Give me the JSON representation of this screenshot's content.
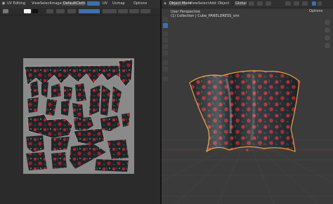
{
  "uv_editor": {
    "header": {
      "editor_type_icon": "image-editor-icon",
      "mode": "UV Editing",
      "menus": [
        "View",
        "Select",
        "Image"
      ],
      "image_name": "DefaultCloth",
      "right_menus": [
        "UV",
        "Uvmap",
        "Options"
      ]
    }
  },
  "viewport": {
    "header": {
      "mode": "Object Mode",
      "menus": [
        "View",
        "Select",
        "Add",
        "Object"
      ],
      "right_menus": [
        "Global",
        "Options"
      ]
    },
    "overlay": {
      "line1": "User Perspective",
      "line2": "(1) Collection | Cube_PANELDRESS_sim"
    },
    "tools": [
      "cursor-icon",
      "move-icon",
      "rotate-icon",
      "scale-icon",
      "transform-icon",
      "annotate-icon",
      "measure-icon",
      "add-cube-icon"
    ]
  },
  "colors": {
    "fabric_base": "#1e2427",
    "rose": "#b3262c",
    "leaf": "#2f5a58",
    "outline": "#f0a040",
    "uv_bg": "#8a8a8a",
    "viewport_bg": "#3b3b3b"
  }
}
